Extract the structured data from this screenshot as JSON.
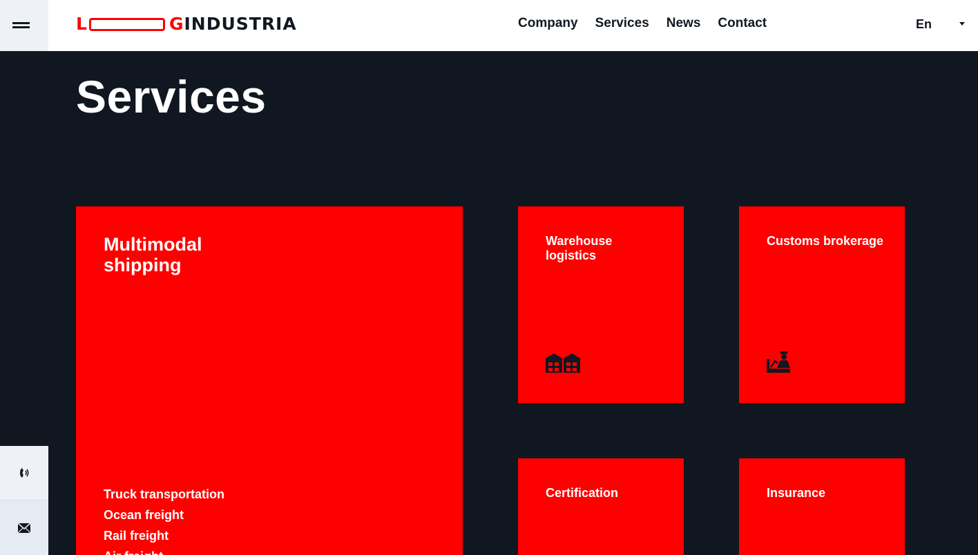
{
  "header": {
    "logo": {
      "part1": "L",
      "part2": "G",
      "part3": "INDUSTRIA"
    },
    "nav": [
      "Company",
      "Services",
      "News",
      "Contact"
    ],
    "language": "En"
  },
  "page": {
    "title": "Services"
  },
  "cards": {
    "multimodal": {
      "title": "Multimodal\n shipping",
      "items": [
        "Truck transportation",
        "Ocean freight",
        "Rail freight",
        "Air freight"
      ]
    },
    "warehouse": {
      "title": "Warehouse logistics",
      "icon": "warehouse-icon"
    },
    "customs": {
      "title": "Customs brokerage",
      "icon": "customs-officer-icon"
    },
    "certification": {
      "title": "Certification"
    },
    "insurance": {
      "title": "Insurance"
    }
  },
  "colors": {
    "accent": "#ff0000",
    "background": "#101720",
    "header": "#ffffff"
  }
}
